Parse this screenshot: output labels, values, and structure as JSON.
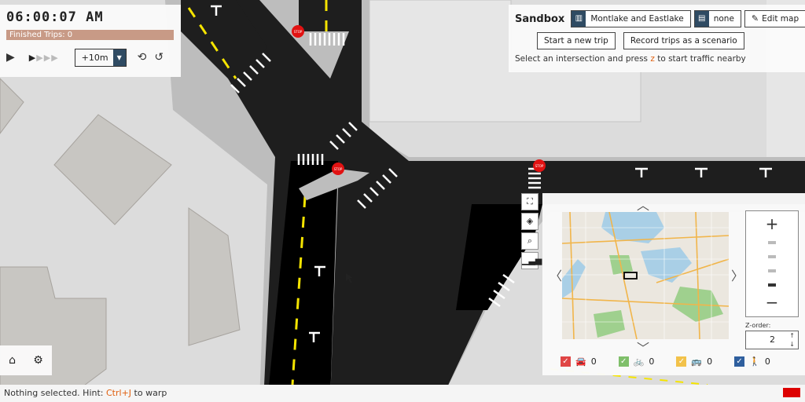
{
  "time_panel": {
    "clock": "06:00:07 AM",
    "finished_trips": "Finished Trips: 0",
    "play_icon": "▶",
    "step_arrows": "▶",
    "step_value": "+10m",
    "dropdown_icon": "▼",
    "reset_icon": "⟲",
    "undo_icon": "↺"
  },
  "sandbox": {
    "title": "Sandbox",
    "map_button": "Montlake and Eastlake",
    "scenario_button": "none",
    "edit_button": "Edit map",
    "new_trip_button": "Start a new trip",
    "record_button": "Record trips as a scenario",
    "hint_prefix": "Select an intersection and press ",
    "hint_key": "z",
    "hint_suffix": " to start traffic nearby"
  },
  "map_tools": [
    "⛶",
    "◈",
    "⌕",
    "▁▃▅"
  ],
  "minimap": {
    "zoom_in": "+",
    "zoom_out": "−",
    "zoom_level": 4,
    "zoom_levels": 5,
    "zorder_label": "Z-order:",
    "zorder_value": "2",
    "filters": [
      {
        "name": "cars",
        "icon": "🚘",
        "count": "0",
        "color": "#e04545"
      },
      {
        "name": "bikes",
        "icon": "🚲",
        "count": "0",
        "color": "#7fbf6a"
      },
      {
        "name": "buses",
        "icon": "🚌",
        "count": "0",
        "color": "#f2c24a"
      },
      {
        "name": "pedestrians",
        "icon": "🚶",
        "count": "0",
        "color": "#2f5f9e"
      }
    ]
  },
  "bottom": {
    "home_icon": "⌂",
    "settings_icon": "⚙",
    "status_prefix": "Nothing selected. Hint: ",
    "status_key": "Ctrl+J",
    "status_suffix": " to warp"
  },
  "map_labels": {
    "stop": "STOP"
  },
  "colors": {
    "road": "#1e1e1e",
    "ground": "#dcdcdc",
    "building": "#c8c6c2",
    "lane_line": "#f5e400",
    "accent": "#2f4b63",
    "stop_sign": "#e11212"
  }
}
